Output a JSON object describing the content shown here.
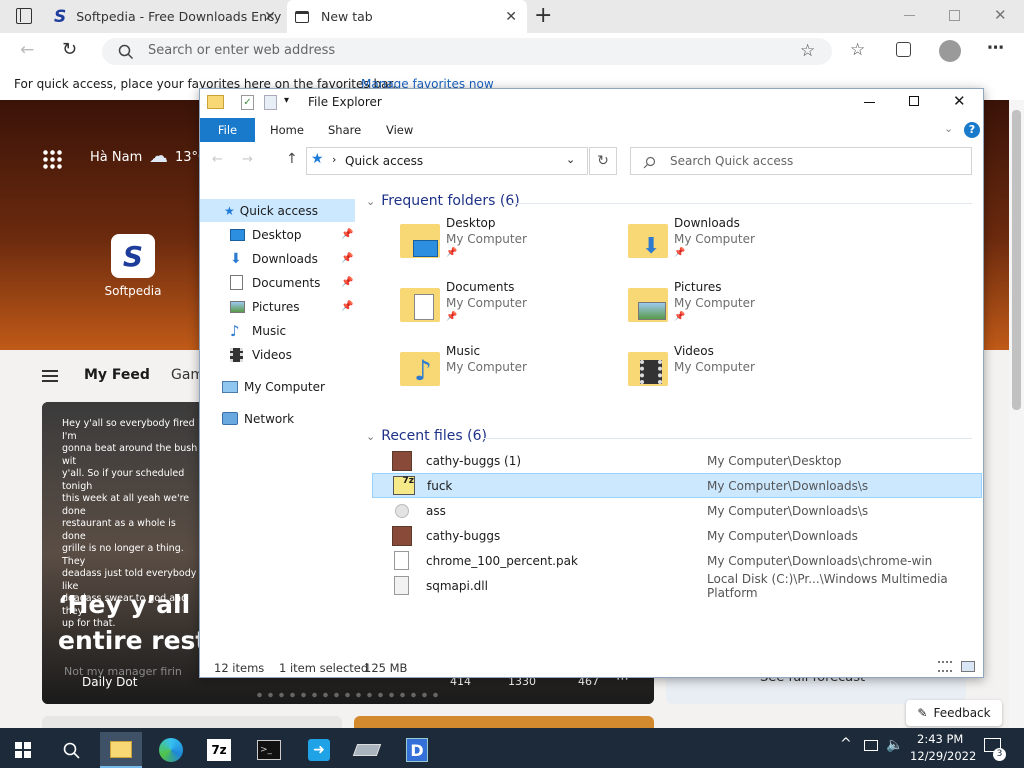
{
  "browser": {
    "tabs": [
      {
        "label": "Softpedia - Free Downloads Ency"
      },
      {
        "label": "New tab"
      }
    ],
    "address_placeholder": "Search or enter web address",
    "favorites_bar_text": "For quick access, place your favorites here on the favorites bar.",
    "favorites_bar_link": "Manage favorites now"
  },
  "newtab": {
    "location": "Hà Nam",
    "temp": "13°C",
    "tile_label": "Softpedia",
    "feed_tab_active": "My Feed",
    "feed_tab_next": "Gam",
    "card": {
      "caption_lines": [
        "Hey y'all so everybody fired I'm",
        "gonna beat around the bush wit",
        "y'all. So if your scheduled tonigh",
        "this week at all yeah we're done",
        "restaurant as a whole is done",
        "grille is no longer a thing. They",
        "deadass just told everybody like",
        "deadass swear to god and they",
        "up for that."
      ],
      "headline_line1": "‘Hey y’all so",
      "headline_line2": "entire resta",
      "subtext": "Not my manager firin",
      "source": "Daily Dot",
      "likes": "414",
      "dislikes": "1330",
      "comments": "467"
    },
    "weather_button": "See full forecast",
    "feedback_label": "Feedback"
  },
  "explorer": {
    "title": "File Explorer",
    "ribbon_tabs": [
      "File",
      "Home",
      "Share",
      "View"
    ],
    "breadcrumb": "Quick access",
    "search_placeholder": "Search Quick access",
    "nav": [
      {
        "label": "Quick access"
      },
      {
        "label": "Desktop"
      },
      {
        "label": "Downloads"
      },
      {
        "label": "Documents"
      },
      {
        "label": "Pictures"
      },
      {
        "label": "Music"
      },
      {
        "label": "Videos"
      },
      {
        "label": "My Computer"
      },
      {
        "label": "Network"
      }
    ],
    "frequent_header": "Frequent folders (6)",
    "frequent": [
      {
        "name": "Desktop",
        "loc": "My Computer"
      },
      {
        "name": "Downloads",
        "loc": "My Computer"
      },
      {
        "name": "Documents",
        "loc": "My Computer"
      },
      {
        "name": "Pictures",
        "loc": "My Computer"
      },
      {
        "name": "Music",
        "loc": "My Computer"
      },
      {
        "name": "Videos",
        "loc": "My Computer"
      }
    ],
    "recent_header": "Recent files (6)",
    "recent": [
      {
        "name": "cathy-buggs (1)",
        "path": "My Computer\\Desktop"
      },
      {
        "name": "fuck",
        "path": "My Computer\\Downloads\\s"
      },
      {
        "name": "ass",
        "path": "My Computer\\Downloads\\s"
      },
      {
        "name": "cathy-buggs",
        "path": "My Computer\\Downloads"
      },
      {
        "name": "chrome_100_percent.pak",
        "path": "My Computer\\Downloads\\chrome-win"
      },
      {
        "name": "sqmapi.dll",
        "path": "Local Disk (C:)\\Pr...\\Windows Multimedia Platform"
      }
    ],
    "status_items": "12 items",
    "status_selected": "1 item selected",
    "status_size": "125 MB"
  },
  "taskbar": {
    "time": "2:43 PM",
    "date": "12/29/2022",
    "notif_count": "3"
  },
  "colors": {
    "accent": "#0063b1",
    "selection": "#cce8ff",
    "folder": "#f8d775"
  }
}
